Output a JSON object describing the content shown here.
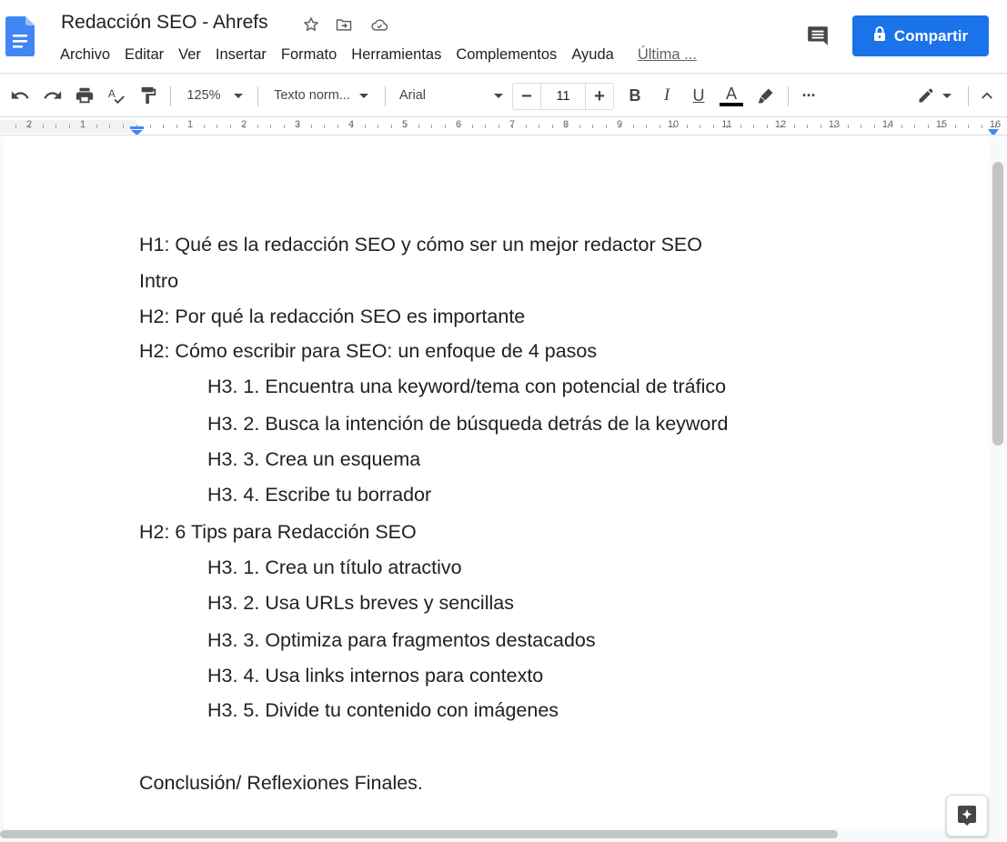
{
  "app": {
    "title": "Redacción SEO - Ahrefs",
    "brand_color": "#4285f4",
    "accent_color": "#1a73e8"
  },
  "menu": [
    "Archivo",
    "Editar",
    "Ver",
    "Insertar",
    "Formato",
    "Herramientas",
    "Complementos",
    "Ayuda"
  ],
  "last_edit": "Última ...",
  "share": {
    "label": "Compartir"
  },
  "toolbar": {
    "zoom": "125%",
    "style": "Texto norm...",
    "font": "Arial",
    "font_size": "11",
    "minus": "−",
    "plus": "+",
    "bold": "B",
    "italic": "I",
    "underline": "U",
    "text_color": "A",
    "more": "···"
  },
  "ruler": [
    "2",
    "1",
    "1",
    "2",
    "3",
    "4",
    "5",
    "6",
    "7",
    "8",
    "9",
    "10",
    "11",
    "12",
    "13",
    "14",
    "15",
    "16"
  ],
  "document": {
    "lines": [
      "H1: Qué es la redacción SEO y cómo ser un mejor redactor SEO",
      "Intro",
      "H2: Por qué la redacción SEO es importante",
      "H2: Cómo escribir para SEO: un enfoque de 4 pasos",
      "H3. 1. Encuentra una keyword/tema con potencial de tráfico",
      "H3. 2. Busca la intención de búsqueda detrás de la keyword",
      "H3. 3. Crea un esquema",
      "H3. 4. Escribe tu borrador",
      "H2: 6 Tips para Redacción SEO",
      "H3. 1. Crea un título atractivo",
      "H3. 2. Usa URLs breves y sencillas",
      "H3. 3. Optimiza para fragmentos destacados",
      "H3. 4. Usa links internos para contexto",
      "H3. 5. Divide tu contenido con imágenes",
      "Conclusión/ Reflexiones Finales."
    ]
  }
}
